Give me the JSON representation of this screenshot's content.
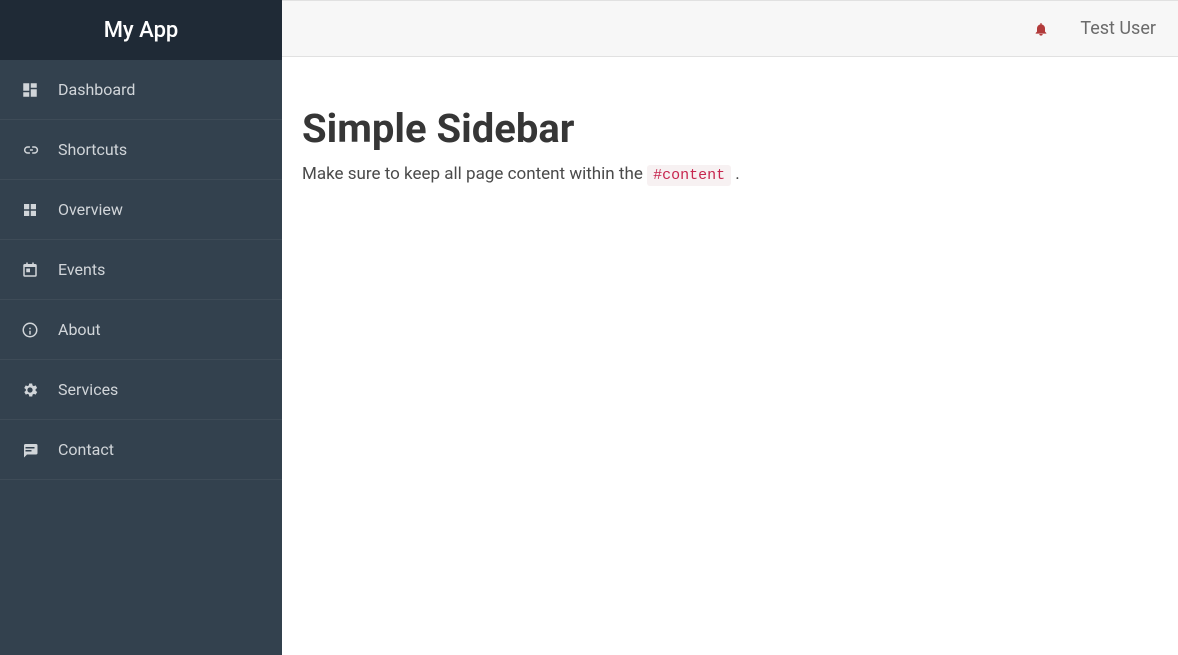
{
  "sidebar": {
    "brand": "My App",
    "items": [
      {
        "label": "Dashboard",
        "icon": "dashboard-icon"
      },
      {
        "label": "Shortcuts",
        "icon": "link-icon"
      },
      {
        "label": "Overview",
        "icon": "apps-icon"
      },
      {
        "label": "Events",
        "icon": "calendar-icon"
      },
      {
        "label": "About",
        "icon": "info-icon"
      },
      {
        "label": "Services",
        "icon": "gear-icon"
      },
      {
        "label": "Contact",
        "icon": "message-icon"
      }
    ]
  },
  "topbar": {
    "user_name": "Test User"
  },
  "content": {
    "title": "Simple Sidebar",
    "description_prefix": "Make sure to keep all page content within the ",
    "description_code": "#content",
    "description_suffix": " ."
  }
}
